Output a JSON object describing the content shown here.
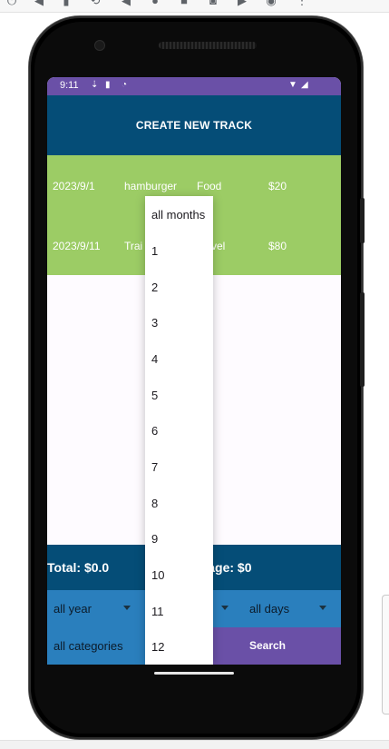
{
  "status_bar": {
    "time": "9:11"
  },
  "header": {
    "title": "CREATE NEW TRACK"
  },
  "tracks": [
    {
      "date": "2023/9/1",
      "name": "hamburger",
      "category": "Food",
      "amount": "$20"
    },
    {
      "date": "2023/9/11",
      "name": "Trai",
      "category": "vel",
      "amount": "$80"
    }
  ],
  "summary": {
    "total": "Total: $0.0",
    "average": "erage: $0"
  },
  "filters": {
    "year": "all year",
    "day": "all days",
    "category": "all categories"
  },
  "search_label": "Search",
  "month_dropdown": {
    "options": [
      "all months",
      "1",
      "2",
      "3",
      "4",
      "5",
      "6",
      "7",
      "8",
      "9",
      "10",
      "11",
      "12"
    ]
  },
  "colors": {
    "header": "#054d77",
    "status_bar": "#6a50a7",
    "rows": "#9ccc65",
    "filters": "#2a7fbd",
    "search": "#6a50a7"
  }
}
